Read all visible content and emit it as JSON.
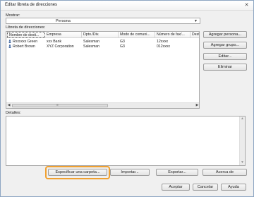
{
  "window": {
    "title": "Editar libreta de direcciones",
    "close_glyph": "✕"
  },
  "filter": {
    "label": "Mostrar:",
    "selected": "Persona"
  },
  "addressbook": {
    "label": "Libreta de direcciones:",
    "columns": [
      "Nombre de desti...",
      "Empresa",
      "Dpto./Div.",
      "Modo de comuni...",
      "Número de fax/...",
      "Desti"
    ],
    "rows": [
      {
        "name": "Rxxxxxx Green",
        "company": "xxx Bank",
        "dept": "Salesman",
        "mode": "G3",
        "number": "12xxxx"
      },
      {
        "name": "Robert Brown",
        "company": "XYZ Corporation",
        "dept": "Salesman",
        "mode": "G3",
        "number": "012xxxx"
      }
    ]
  },
  "side_buttons": {
    "add_person": "Agregar persona...",
    "add_group": "Agregar grupo...",
    "edit": "Editar...",
    "delete": "Eliminar"
  },
  "details": {
    "label": "Detalles:"
  },
  "bottom_buttons": {
    "specify_folder": "Especificar una carpeta...",
    "import": "Importar...",
    "export": "Exportar...",
    "about": "Acerca de"
  },
  "dialog_buttons": {
    "accept": "Aceptar",
    "cancel": "Cancelar",
    "help": "Ayuda"
  },
  "icons": {
    "person": "person-icon",
    "dropdown": "chevron-down-icon"
  },
  "colors": {
    "highlight": "#f0a030"
  }
}
